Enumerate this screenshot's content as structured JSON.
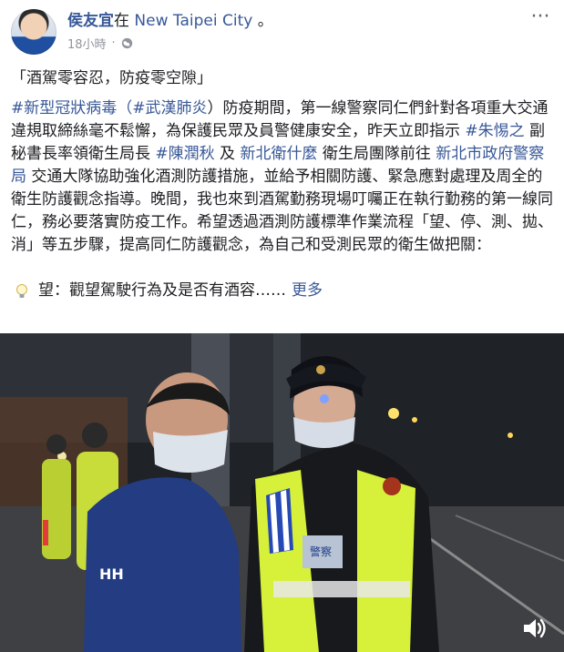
{
  "post": {
    "author": "侯友宜",
    "location_prefix": "在",
    "location": "New Taipei City",
    "location_suffix": "。",
    "time": "18小時",
    "dot": "·",
    "more": "···",
    "title": "「酒駕零容忍，防疫零空隙」",
    "body": [
      {
        "t": "#新型冠狀病毒",
        "tag": true
      },
      {
        "t": "（",
        "tag": true
      },
      {
        "t": "#武漢肺炎",
        "tag": true
      },
      {
        "t": "）防疫期間，第一線警察同仁們針對各項重大交通違規取締絲毫不鬆懈，為保護民眾及員警健康安全，昨天立即指示 ",
        "tag": false
      },
      {
        "t": "#朱惕之",
        "tag": true
      },
      {
        "t": " 副秘書長率領衛生局長 ",
        "tag": false
      },
      {
        "t": "#陳潤秋",
        "tag": true
      },
      {
        "t": " 及 ",
        "tag": false
      },
      {
        "t": "新北衛什麼",
        "tag": true
      },
      {
        "t": " 衛生局團隊前往 ",
        "tag": false
      },
      {
        "t": "新北市政府警察局",
        "tag": true
      },
      {
        "t": " 交通大隊協助強化酒測防護措施，並給予相關防護、緊急應對處理及周全的衛生防護觀念指導。晚間，我也來到酒駕勤務現場叮囑正在執行勤務的第一線同仁，務必要落實防疫工作。希望透過酒測防護標準作業流程「望、停、測、拋、消」等五步驟，提高同仁防護觀念，為自己和受測民眾的衛生做把關：",
        "tag": false
      }
    ],
    "tip": "望：觀望駕駛行為及是否有酒容……",
    "see_more": "更多"
  },
  "photo": {
    "vest_label": "警察"
  },
  "icons": {
    "globe": "globe-icon",
    "bulb": "lightbulb-icon",
    "sound": "speaker-icon"
  },
  "colors": {
    "link": "#385898",
    "meta": "#90949c",
    "vest": "#d7f03a"
  }
}
